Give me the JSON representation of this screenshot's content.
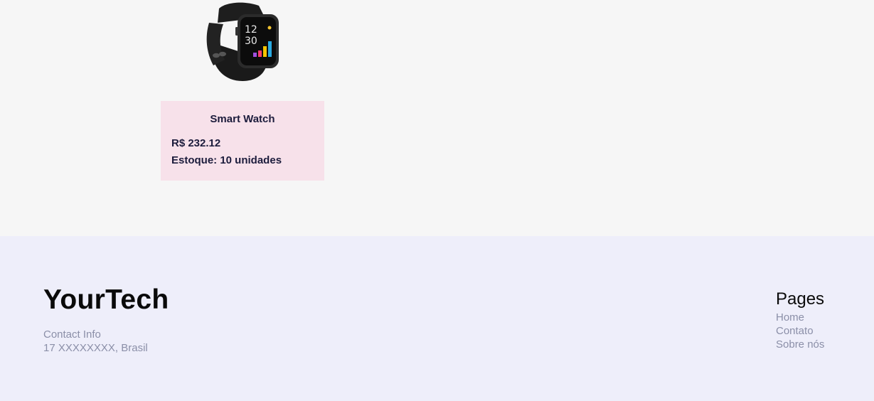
{
  "product": {
    "name": "Smart Watch",
    "price": "R$ 232.12",
    "stock": "Estoque: 10 unidades",
    "image_icon": "smartwatch-image",
    "watch_time": [
      "12",
      "30"
    ],
    "card_color": "#f7e1ea"
  },
  "footer": {
    "brand": "YourTech",
    "contact_label": "Contact Info",
    "contact_address": "17 XXXXXXXX, Brasil",
    "pages_title": "Pages",
    "links": [
      "Home",
      "Contato",
      "Sobre nós"
    ],
    "background": "#eeeefa"
  }
}
